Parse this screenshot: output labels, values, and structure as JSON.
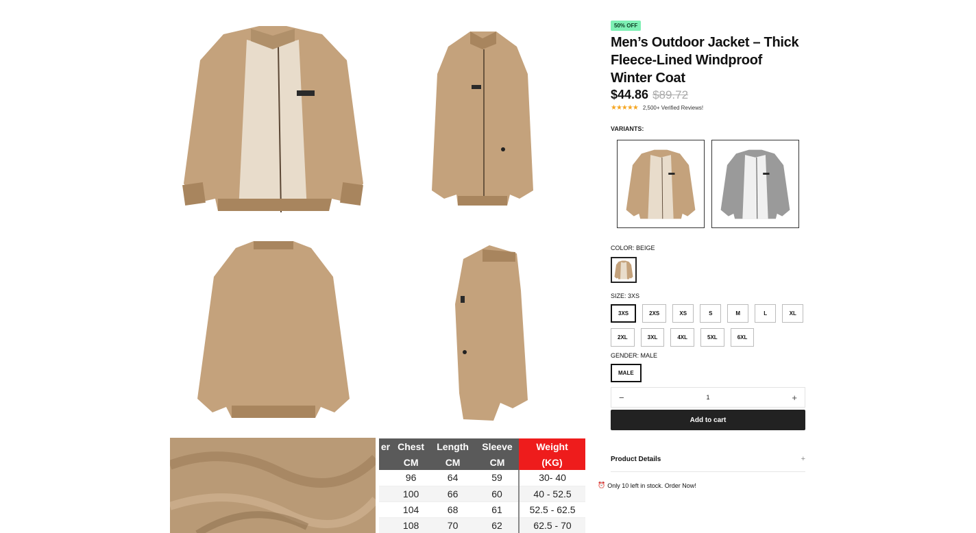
{
  "product": {
    "badge": "50% OFF",
    "title": "Men’s Outdoor Jacket – Thick Fleece-Lined Windproof Winter Coat",
    "price": "$44.86",
    "old_price": "$89.72",
    "stars": "★★★★★",
    "reviews": "2,500+ Verified Reviews!"
  },
  "variants": {
    "label": "VARIANTS:",
    "items": [
      "beige-jacket",
      "gray-jacket"
    ]
  },
  "color": {
    "label": "COLOR: BEIGE"
  },
  "size": {
    "label": "SIZE: 3XS",
    "options": [
      "3XS",
      "2XS",
      "XS",
      "S",
      "M",
      "L",
      "XL",
      "2XL",
      "3XL",
      "4XL",
      "5XL",
      "6XL"
    ],
    "selected": "3XS"
  },
  "gender": {
    "label": "GENDER: MALE",
    "option": "MALE"
  },
  "quantity": {
    "minus": "−",
    "value": "1",
    "plus": "+"
  },
  "cart": {
    "label": "Add to cart"
  },
  "details": {
    "label": "Product Details",
    "toggle": "+"
  },
  "stock": {
    "icon": "⏰",
    "text": "Only 10 left in stock. Order Now!"
  },
  "size_table": {
    "headers": [
      "er",
      "Chest",
      "Length",
      "Sleeve",
      "Weight"
    ],
    "units": [
      "",
      "CM",
      "CM",
      "CM",
      "(KG)"
    ],
    "rows": [
      [
        "",
        "96",
        "64",
        "59",
        "30- 40"
      ],
      [
        "",
        "100",
        "66",
        "60",
        "40 - 52.5"
      ],
      [
        "",
        "104",
        "68",
        "61",
        "52.5 - 62.5"
      ],
      [
        "",
        "108",
        "70",
        "62",
        "62.5 - 70"
      ]
    ]
  },
  "colors": {
    "beige": "#c4a27c",
    "beige_dark": "#a8855e",
    "fleece": "#e8dccb",
    "gray": "#9a9a9a",
    "accent_green": "#7ef0b4",
    "weight_red": "#ee1c1c"
  }
}
